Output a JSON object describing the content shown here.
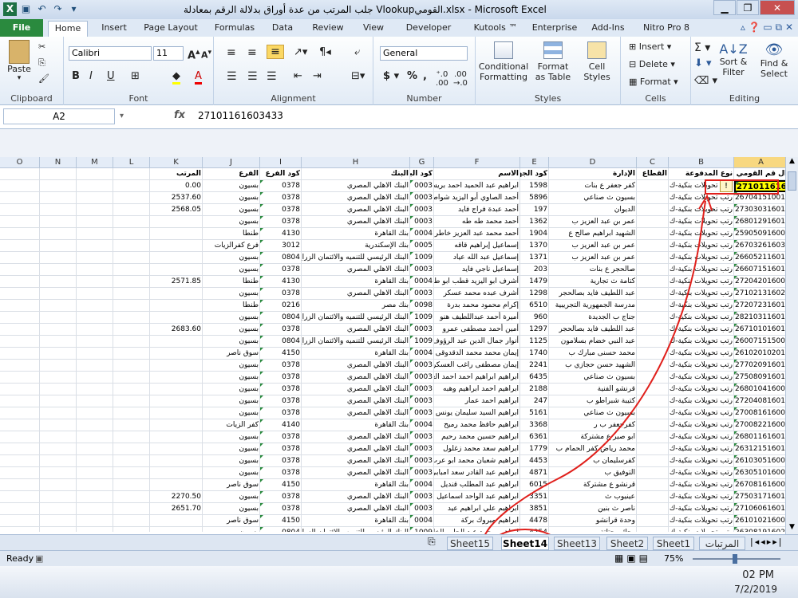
{
  "window": {
    "title": "جلب المرتب من عدة أوراق بدلالة الرقم  بمعادلة Vlookupالقومي.xlsx  -  Microsoft Excel"
  },
  "tabs": [
    "File",
    "Home",
    "Insert",
    "Page Layout",
    "Formulas",
    "Data",
    "Review",
    "View",
    "Developer",
    "Kutools ™",
    "Enterprise",
    "Add-Ins",
    "Nitro Pro 8"
  ],
  "ribbon": {
    "clipboard": {
      "label": "Clipboard",
      "paste": "Paste"
    },
    "font": {
      "label": "Font",
      "name": "Calibri",
      "size": "11"
    },
    "alignment": {
      "label": "Alignment"
    },
    "number": {
      "label": "Number",
      "format": "General"
    },
    "styles": {
      "label": "Styles",
      "conditional": "Conditional Formatting",
      "format_table": "Format as Table",
      "cell_styles": "Cell Styles"
    },
    "cells": {
      "label": "Cells",
      "insert": "Insert",
      "delete": "Delete",
      "format": "Format"
    },
    "editing": {
      "label": "Editing",
      "sort": "Sort & Filter",
      "find": "Find & Select"
    }
  },
  "formula_bar": {
    "name_box": "A2",
    "fx": "fx",
    "value": "27101161603433"
  },
  "columns": [
    "O",
    "N",
    "M",
    "L",
    "K",
    "J",
    "I",
    "H",
    "G",
    "F",
    "E",
    "D",
    "C",
    "B",
    "A"
  ],
  "headers": {
    "K": "المرتب",
    "J": "الفرع",
    "I": "كود الفرع",
    "H": "البنك",
    "G": "كود البنك",
    "F": "الاسم",
    "E": "كود الجهة",
    "D": "الإدارة",
    "C": "القطاع",
    "B": "نوع المدفوعة",
    "A": "ال قم القومي"
  },
  "rows": [
    {
      "n": 2,
      "A": "27101161603433",
      "B": "رتب تحويلات بنكية-ك",
      "D": "كفر جعفر    ع    بنات",
      "E": "1598",
      "F": "ابراهيم عبد الحميد احمد بريش",
      "G": "0003",
      "H": "البنك الاهلي المصري",
      "I": "0378",
      "J": "بسيون",
      "K": "0.00"
    },
    {
      "n": 3,
      "A": "26704151001253",
      "B": "رتب تحويلات بنكية-ك",
      "D": "بسيون   ث   صناعي",
      "E": "5896",
      "F": "أحمد الصاوي أبو اليزيد شواط",
      "G": "0003",
      "H": "البنك الاهلي المصري",
      "I": "0378",
      "J": "بسيون",
      "K": "2537.60"
    },
    {
      "n": 4,
      "A": "27303031601473",
      "B": "رتب تحويلات بنكية-ك",
      "D": "الديوان",
      "E": "197",
      "F": "أحمد عبدة فراج فايد",
      "G": "0003",
      "H": "البنك الاهلي المصري",
      "I": "0378",
      "J": "بسيون",
      "K": "2568.05"
    },
    {
      "n": 5,
      "A": "26801291601597",
      "B": "رتب تحويلات بنكية-ك",
      "D": "عمر بن عبد العزيز   ب",
      "E": "1362",
      "F": "أحمد محمد طه طه",
      "G": "0003",
      "H": "البنك الاهلي المصري",
      "I": "0378",
      "J": "بسيون",
      "K": ""
    },
    {
      "n": 6,
      "A": "25905091600333",
      "B": "رتب تحويلات بنكية-ك",
      "D": "الشهيد ابراهيم صالح  ع",
      "E": "1904",
      "F": "أحمد محمد عبد العزيز خاطر",
      "G": "0004",
      "H": "بنك القاهرة",
      "I": "4130",
      "J": "طنطا",
      "K": ""
    },
    {
      "n": 7,
      "A": "26703261603054",
      "B": "رتب تحويلات بنكية-ك",
      "D": "عمر بن عبد العزيز   ب",
      "E": "1370",
      "F": "إسماعيل إبراهيم قاقه",
      "G": "0005",
      "H": "بنك الإسكندرية",
      "I": "3012",
      "J": "فرع كفرالزيات",
      "K": ""
    },
    {
      "n": 8,
      "A": "26605211601199",
      "B": "رتب تحويلات بنكية-ك",
      "D": "عمر بن عبد العزيز   ب",
      "E": "1371",
      "F": "إسماعيل عبد الله عياد",
      "G": "1009",
      "H": "البنك الرئيسي للتنميه والائتمان الزراع",
      "I": "0804",
      "J": "بسيون",
      "K": ""
    },
    {
      "n": 9,
      "A": "26607151601553",
      "B": "رتب تحويلات بنكية-ك",
      "D": "صالحجر   ع   بنات",
      "E": "203",
      "F": "إسماعيل ناجي فايد",
      "G": "0003",
      "H": "البنك الاهلي المصري",
      "I": "0378",
      "J": "بسيون",
      "K": ""
    },
    {
      "n": 10,
      "A": "27204201600975",
      "B": "رتب تحويلات بنكية-ك",
      "D": "كتامة  ث  تجارية",
      "E": "1479",
      "F": "أشرف ابو اليزيد قطب ابو طالب",
      "G": "0004",
      "H": "بنك القاهرة",
      "I": "4130",
      "J": "طنطا",
      "K": "2571.85"
    },
    {
      "n": 11,
      "A": "27102131602455",
      "B": "رتب تحويلات بنكية-ك",
      "D": "عبد اللطيف فايد بصالحجر",
      "E": "1298",
      "F": "أشرف عبده محمد عسكر",
      "G": "0003",
      "H": "البنك الاهلي المصري",
      "I": "0378",
      "J": "بسيون",
      "K": ""
    },
    {
      "n": 12,
      "A": "27207231601703",
      "B": "رتب تحويلات بنكية-ك",
      "D": "مدرسة الجمهورية التجريبية",
      "E": "6510",
      "F": "إكرام محمود محمد بدرة",
      "G": "0098",
      "H": "بنك مصر",
      "I": "0216",
      "J": "طنطا",
      "K": ""
    },
    {
      "n": 13,
      "A": "28210311601083",
      "B": "رتب تحويلات بنكية-ك",
      "D": "جناج   ب   الجديدة",
      "E": "960",
      "F": "أميرة أحمد عبداللطيف هنو",
      "G": "1009",
      "H": "البنك الرئيسي للتنميه والائتمان الزراع",
      "I": "0804",
      "J": "بسيون",
      "K": ""
    },
    {
      "n": 14,
      "A": "26710101601574",
      "B": "رتب تحويلات بنكية-ك",
      "D": "عبد اللطيف فايد بصالحجر",
      "E": "1297",
      "F": "أمين أحمد مصطفى عمرو",
      "G": "0003",
      "H": "البنك الاهلي المصري",
      "I": "0378",
      "J": "بسيون",
      "K": "2683.60"
    },
    {
      "n": 15,
      "A": "26007151500486",
      "B": "رتب تحويلات بنكية-ك",
      "D": "عبد النبي خضام  بسلامون",
      "E": "1125",
      "F": "أنوار جمال الدين عبد الرؤوف",
      "G": "1009",
      "H": "البنك الرئيسي للتنميه والائتمان الزراع",
      "I": "0804",
      "J": "بسيون",
      "K": ""
    },
    {
      "n": 16,
      "A": "26102010201182",
      "B": "رتب تحويلات بنكية-ك",
      "D": "محمد حسنى مبارك   ب",
      "E": "1740",
      "F": "إيمان محمد محمد الدقدوقى",
      "G": "0004",
      "H": "بنك القاهرة",
      "I": "4150",
      "J": "سوق ناصر",
      "K": ""
    },
    {
      "n": 17,
      "A": "27702091601468",
      "B": "رتب تحويلات بنكية-ك",
      "D": "الشهيد حسن حجازي   ب",
      "E": "2241",
      "F": "إيمان مصطفى راغب العسكرى",
      "G": "0003",
      "H": "البنك الاهلي المصري",
      "I": "0378",
      "J": "بسيون",
      "K": ""
    },
    {
      "n": 18,
      "A": "27508091601457",
      "B": "رتب تحويلات بنكية-ك",
      "D": "بسيون   ث   صناعي",
      "E": "6435",
      "F": "ابراهيم ابراهيم احمد احمد العلا",
      "G": "0003",
      "H": "البنك الاهلي المصري",
      "I": "0378",
      "J": "بسيون",
      "K": ""
    },
    {
      "n": 19,
      "A": "26801041600456",
      "B": "رتب تحويلات بنكية-ك",
      "D": "قرنشو الفنية",
      "E": "2188",
      "F": "ابراهيم احمد ابراهيم وهبه",
      "G": "0003",
      "H": "البنك الاهلي المصري",
      "I": "0378",
      "J": "بسيون",
      "K": ""
    },
    {
      "n": 20,
      "A": "27204081601298",
      "B": "رتب تحويلات بنكية-ك",
      "D": "كتيبة شبراطو   ب",
      "E": "247",
      "F": "ابراهيم احمد عمار",
      "G": "0003",
      "H": "البنك الاهلي المصري",
      "I": "0378",
      "J": "بسيون",
      "K": ""
    },
    {
      "n": 21,
      "A": "27008161600957",
      "B": "رتب تحويلات بنكية-ك",
      "D": "بسيون   ث   صناعي",
      "E": "5161",
      "F": "ابراهيم السيد سليمان يونس الد",
      "G": "0003",
      "H": "البنك الاهلي المصري",
      "I": "0378",
      "J": "بسيون",
      "K": ""
    },
    {
      "n": 22,
      "A": "27008221600871",
      "B": "رتب تحويلات بنكية-ك",
      "D": "كفرجعفر   ب   ر",
      "E": "3368",
      "F": "ابراهيم حافظ محمد رميح",
      "G": "0004",
      "H": "بنك القاهرة",
      "I": "4140",
      "J": "كفر الزيات",
      "K": ""
    },
    {
      "n": 23,
      "A": "26801161601633",
      "B": "رتب تحويلات بنكية-ك",
      "D": "ابو صير  ع   مشتركة",
      "E": "6361",
      "F": "ابراهيم حسين محمد رحيم",
      "G": "0003",
      "H": "البنك الاهلي المصري",
      "I": "0378",
      "J": "بسيون",
      "K": ""
    },
    {
      "n": 24,
      "A": "26312151601517",
      "B": "رتب تحويلات بنكية-ك",
      "D": "محمد رياض كفر الحمام   ب",
      "E": "1779",
      "F": "ابراهيم سعد محمد زغلول",
      "G": "0003",
      "H": "البنك الاهلي المصري",
      "I": "0378",
      "J": "بسيون",
      "K": ""
    },
    {
      "n": 25,
      "A": "26103051600457",
      "B": "رتب تحويلات بنكية-ك",
      "D": "كفرسليمان   ب",
      "E": "4453",
      "F": "ابراهيم شعبان محمد ابو عرب",
      "G": "0003",
      "H": "البنك الاهلي المصري",
      "I": "0378",
      "J": "بسيون",
      "K": ""
    },
    {
      "n": 26,
      "A": "26305101600975",
      "B": "رتب تحويلات بنكية-ك",
      "D": "التوفيق   ب",
      "E": "4871",
      "F": "ابراهيم عبد القادر سعد امبابي",
      "G": "0003",
      "H": "البنك الاهلي المصري",
      "I": "0378",
      "J": "بسيون",
      "K": ""
    },
    {
      "n": 27,
      "A": "26708161600953",
      "B": "رتب تحويلات بنكية-ك",
      "D": "قرنشو   ع  مشتركة",
      "E": "6015",
      "F": "ابراهيم عبد المطلب قنديل",
      "G": "0004",
      "H": "بنك القاهرة",
      "I": "4150",
      "J": "سوق ناصر",
      "K": ""
    },
    {
      "n": 28,
      "A": "27503171601316",
      "B": "رتب تحويلات بنكية-ك",
      "D": "عينيوب ث",
      "E": "3351",
      "F": "ابراهيم عبد الواحد اسماعيل ما",
      "G": "0003",
      "H": "البنك الاهلي المصري",
      "I": "0378",
      "J": "بسيون",
      "K": "2270.50"
    },
    {
      "n": 29,
      "A": "27106061601052",
      "B": "رتب تحويلات بنكية-ك",
      "D": "ناصر   ث  بنين",
      "E": "3851",
      "F": "ابراهيم علي ابراهيم عيد",
      "G": "0003",
      "H": "البنك الاهلي المصري",
      "I": "0378",
      "J": "بسيون",
      "K": "2651.70"
    },
    {
      "n": 30,
      "A": "26101021600473",
      "B": "رتب تحويلات بنكية-ك",
      "D": "وحدة قرانشو",
      "E": "4478",
      "F": "ابراهيم مبروك بركة",
      "G": "0004",
      "H": "بنك القاهرة",
      "I": "4150",
      "J": "سوق ناصر",
      "K": ""
    },
    {
      "n": 31,
      "A": "26308191602679",
      "B": "رتب تحويلات بنكية-ك",
      "D": "رجائى حتاتة   ب",
      "E": "4254",
      "F": "ابراهيم محمد عبد الحليم الخايش",
      "G": "1009",
      "H": "البنك الرئيسي للتنميه والائتمان الزراع",
      "I": "0804",
      "J": "بسيون",
      "K": ""
    }
  ],
  "sheets": [
    "Sheet15",
    "Sheet14",
    "Sheet13",
    "Sheet2",
    "Sheet1",
    "المرتبات"
  ],
  "active_sheet": "Sheet14",
  "status": {
    "ready": "Ready",
    "zoom": "75%"
  },
  "taskbar": {
    "time": "02 PM",
    "date": "7/2/2019"
  },
  "colors": {
    "file_tab": "#2a8a3e",
    "annotation": "#e0201c",
    "selection_header": "#f8d880"
  }
}
